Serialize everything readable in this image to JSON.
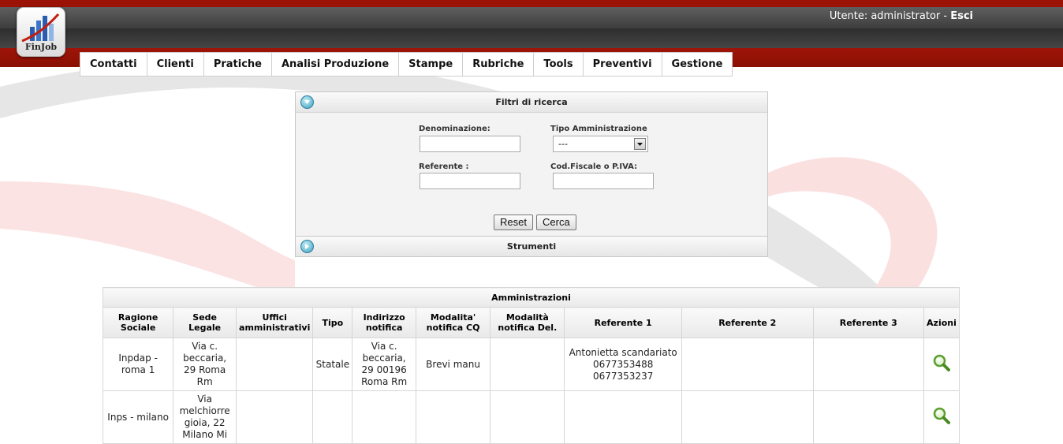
{
  "app": {
    "logo_text": "FinJob"
  },
  "user": {
    "prefix": "Utente: administrator - ",
    "logout": "Esci"
  },
  "nav": [
    {
      "label": "Contatti",
      "name": "nav-contatti"
    },
    {
      "label": "Clienti",
      "name": "nav-clienti"
    },
    {
      "label": "Pratiche",
      "name": "nav-pratiche"
    },
    {
      "label": "Analisi Produzione",
      "name": "nav-analisi-produzione"
    },
    {
      "label": "Stampe",
      "name": "nav-stampe"
    },
    {
      "label": "Rubriche",
      "name": "nav-rubriche"
    },
    {
      "label": "Tools",
      "name": "nav-tools"
    },
    {
      "label": "Preventivi",
      "name": "nav-preventivi"
    },
    {
      "label": "Gestione",
      "name": "nav-gestione"
    }
  ],
  "filters": {
    "title": "Filtri di ricerca",
    "denominazione": {
      "label": "Denominazione:",
      "value": ""
    },
    "tipo": {
      "label": "Tipo Amministrazione",
      "value": "---"
    },
    "referente": {
      "label": "Referente :",
      "value": ""
    },
    "codfiscale": {
      "label": "Cod.Fiscale o P.IVA:",
      "value": ""
    },
    "reset_label": "Reset",
    "search_label": "Cerca"
  },
  "tools": {
    "title": "Strumenti"
  },
  "table": {
    "caption": "Amministrazioni",
    "headers": [
      "Ragione Sociale",
      "Sede Legale",
      "Uffici amministrativi",
      "Tipo",
      "Indirizzo notifica",
      "Modalita' notifica CQ",
      "Modalità notifica Del.",
      "Referente 1",
      "Referente 2",
      "Referente 3",
      "Azioni"
    ],
    "rows": [
      {
        "ragione": "Inpdap - roma 1",
        "sede": "Via c. beccaria, 29 Roma Rm",
        "uffici": "",
        "tipo": "Statale",
        "indirizzo": "Via c. beccaria, 29 00196 Roma Rm",
        "mod_cq": "Brevi manu",
        "mod_del": "",
        "ref1_name": "Antonietta scandariato",
        "ref1_phone1": "0677353488",
        "ref1_phone2": "0677353237",
        "ref2": "",
        "ref3": ""
      },
      {
        "ragione": "Inps - milano",
        "sede": "Via melchiorre gioia, 22 Milano Mi",
        "uffici": "",
        "tipo": "",
        "indirizzo": "",
        "mod_cq": "",
        "mod_del": "",
        "ref1_name": "",
        "ref1_phone1": "",
        "ref1_phone2": "",
        "ref2": "",
        "ref3": ""
      }
    ]
  },
  "colors": {
    "brand_red": "#9b1206",
    "bar_dark": "#3d3d3d"
  }
}
